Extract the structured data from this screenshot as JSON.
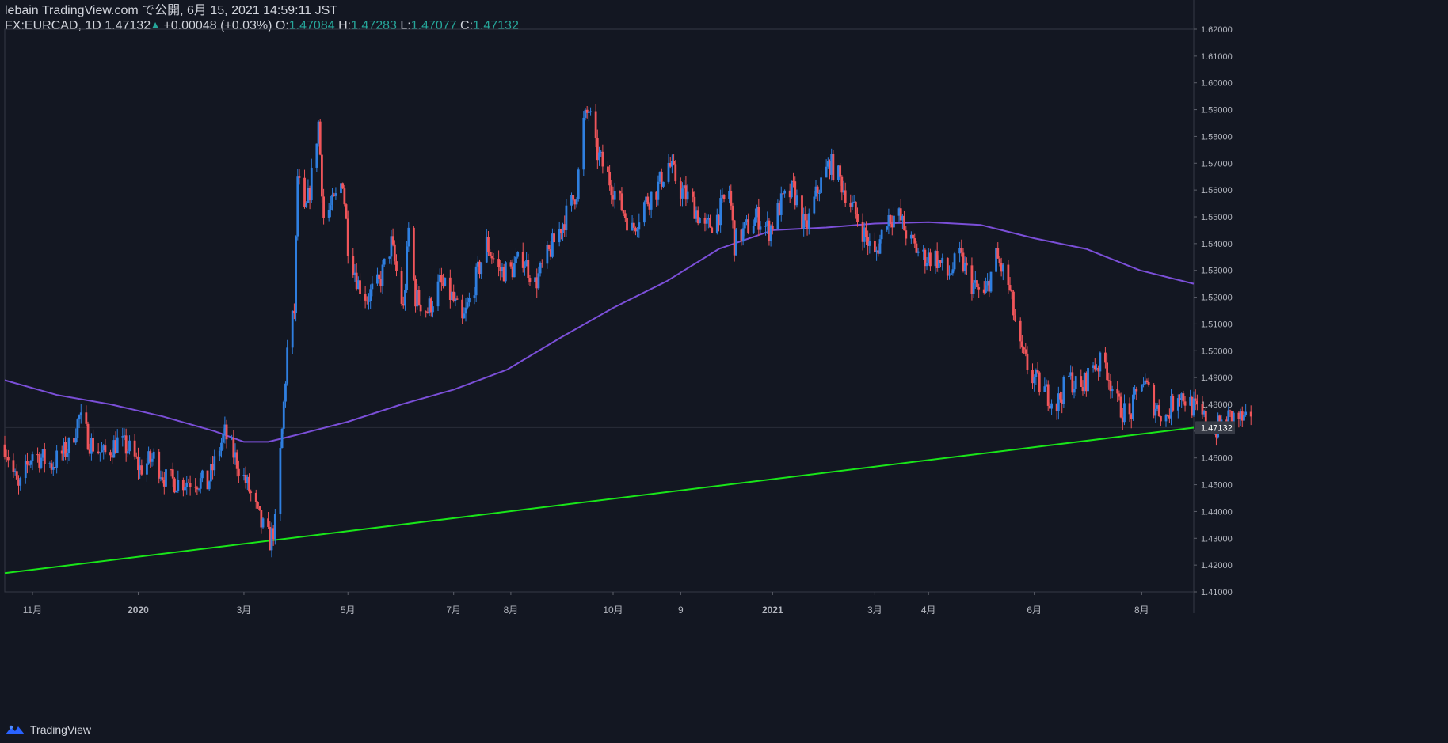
{
  "header": {
    "published": "lebain TradingView.com で公開, 6月 15, 2021 14:59:11 JST",
    "symbol": "FX:EURCAD, 1D",
    "last": "1.47132",
    "change": "+0.00048 (+0.03%)",
    "o_label": "O:",
    "o_value": "1.47084",
    "h_label": "H:",
    "h_value": "1.47283",
    "l_label": "L:",
    "l_value": "1.47077",
    "c_label": "C:",
    "c_value": "1.47132"
  },
  "footer": {
    "brand": "TradingView"
  },
  "colors": {
    "background": "#131722",
    "up": "#2f7fe0",
    "down": "#f0555a",
    "ma": "#7b4fd8",
    "trendline": "#19e619",
    "text": "#d1d4dc",
    "header_value": "#26a69a"
  },
  "chart_data": {
    "type": "candlestick",
    "symbol": "FX:EURCAD",
    "timeframe": "1D",
    "x_range": [
      "2019-10-16",
      "2021-09-01"
    ],
    "y_range": [
      1.41,
      1.62
    ],
    "y_ticks": [
      "1.41000",
      "1.42000",
      "1.43000",
      "1.44000",
      "1.45000",
      "1.46000",
      "1.47000",
      "1.48000",
      "1.49000",
      "1.50000",
      "1.51000",
      "1.52000",
      "1.53000",
      "1.54000",
      "1.55000",
      "1.56000",
      "1.57000",
      "1.58000",
      "1.59000",
      "1.60000",
      "1.61000",
      "1.62000"
    ],
    "x_ticks": [
      {
        "label": "11月",
        "date": "2019-11-01"
      },
      {
        "label": "2020",
        "date": "2020-01-01"
      },
      {
        "label": "3月",
        "date": "2020-03-02"
      },
      {
        "label": "5月",
        "date": "2020-05-01"
      },
      {
        "label": "7月",
        "date": "2020-07-01"
      },
      {
        "label": "8月",
        "date": "2020-08-03"
      },
      {
        "label": "10月",
        "date": "2020-10-01"
      },
      {
        "label": "9",
        "date": "2020-11-09"
      },
      {
        "label": "2021",
        "date": "2021-01-01"
      },
      {
        "label": "3月",
        "date": "2021-03-01"
      },
      {
        "label": "4月",
        "date": "2021-04-01"
      },
      {
        "label": "6月",
        "date": "2021-06-01"
      },
      {
        "label": "8月",
        "date": "2021-08-02"
      }
    ],
    "last_price_label": "1.47132",
    "last_price": 1.47132,
    "close_path": [
      [
        "2019-10-16",
        1.465
      ],
      [
        "2019-10-24",
        1.448
      ],
      [
        "2019-11-01",
        1.462
      ],
      [
        "2019-11-12",
        1.4575
      ],
      [
        "2019-11-22",
        1.464
      ],
      [
        "2019-11-28",
        1.475
      ],
      [
        "2019-12-04",
        1.466
      ],
      [
        "2019-12-12",
        1.461
      ],
      [
        "2019-12-20",
        1.466
      ],
      [
        "2019-12-27",
        1.463
      ],
      [
        "2020-01-02",
        1.456
      ],
      [
        "2020-01-10",
        1.46
      ],
      [
        "2020-01-17",
        1.452
      ],
      [
        "2020-01-24",
        1.451
      ],
      [
        "2020-02-03",
        1.452
      ],
      [
        "2020-02-10",
        1.45
      ],
      [
        "2020-02-17",
        1.464
      ],
      [
        "2020-02-20",
        1.469
      ],
      [
        "2020-02-26",
        1.46
      ],
      [
        "2020-03-05",
        1.448
      ],
      [
        "2020-03-12",
        1.435
      ],
      [
        "2020-03-17",
        1.429
      ],
      [
        "2020-03-20",
        1.435
      ],
      [
        "2020-03-24",
        1.47
      ],
      [
        "2020-03-27",
        1.5
      ],
      [
        "2020-03-31",
        1.515
      ],
      [
        "2020-04-02",
        1.565
      ],
      [
        "2020-04-06",
        1.55
      ],
      [
        "2020-04-09",
        1.56
      ],
      [
        "2020-04-14",
        1.585
      ],
      [
        "2020-04-17",
        1.55
      ],
      [
        "2020-04-23",
        1.555
      ],
      [
        "2020-04-28",
        1.564
      ],
      [
        "2020-05-01",
        1.54
      ],
      [
        "2020-05-07",
        1.525
      ],
      [
        "2020-05-12",
        1.52
      ],
      [
        "2020-05-19",
        1.525
      ],
      [
        "2020-05-26",
        1.54
      ],
      [
        "2020-06-02",
        1.515
      ],
      [
        "2020-06-05",
        1.545
      ],
      [
        "2020-06-09",
        1.52
      ],
      [
        "2020-06-16",
        1.515
      ],
      [
        "2020-06-23",
        1.525
      ],
      [
        "2020-06-30",
        1.52
      ],
      [
        "2020-07-06",
        1.51
      ],
      [
        "2020-07-13",
        1.525
      ],
      [
        "2020-07-20",
        1.54
      ],
      [
        "2020-07-27",
        1.53
      ],
      [
        "2020-08-03",
        1.53
      ],
      [
        "2020-08-10",
        1.535
      ],
      [
        "2020-08-17",
        1.525
      ],
      [
        "2020-08-24",
        1.535
      ],
      [
        "2020-08-31",
        1.545
      ],
      [
        "2020-09-07",
        1.555
      ],
      [
        "2020-09-10",
        1.56
      ],
      [
        "2020-09-14",
        1.585
      ],
      [
        "2020-09-17",
        1.59
      ],
      [
        "2020-09-21",
        1.575
      ],
      [
        "2020-09-28",
        1.565
      ],
      [
        "2020-10-05",
        1.555
      ],
      [
        "2020-10-12",
        1.545
      ],
      [
        "2020-10-19",
        1.555
      ],
      [
        "2020-10-26",
        1.56
      ],
      [
        "2020-11-02",
        1.57
      ],
      [
        "2020-11-09",
        1.56
      ],
      [
        "2020-11-16",
        1.555
      ],
      [
        "2020-11-23",
        1.545
      ],
      [
        "2020-11-30",
        1.55
      ],
      [
        "2020-12-07",
        1.56
      ],
      [
        "2020-12-10",
        1.54
      ],
      [
        "2020-12-16",
        1.545
      ],
      [
        "2020-12-23",
        1.55
      ],
      [
        "2020-12-30",
        1.545
      ],
      [
        "2021-01-06",
        1.555
      ],
      [
        "2021-01-13",
        1.56
      ],
      [
        "2021-01-20",
        1.545
      ],
      [
        "2021-01-27",
        1.56
      ],
      [
        "2021-02-03",
        1.57
      ],
      [
        "2021-02-08",
        1.565
      ],
      [
        "2021-02-15",
        1.555
      ],
      [
        "2021-02-22",
        1.545
      ],
      [
        "2021-03-01",
        1.535
      ],
      [
        "2021-03-08",
        1.55
      ],
      [
        "2021-03-15",
        1.55
      ],
      [
        "2021-03-22",
        1.54
      ],
      [
        "2021-03-29",
        1.535
      ],
      [
        "2021-04-05",
        1.535
      ],
      [
        "2021-04-12",
        1.528
      ],
      [
        "2021-04-19",
        1.535
      ],
      [
        "2021-04-26",
        1.525
      ],
      [
        "2021-05-03",
        1.52
      ],
      [
        "2021-05-10",
        1.535
      ],
      [
        "2021-05-17",
        1.525
      ],
      [
        "2021-05-24",
        1.5
      ],
      [
        "2021-05-31",
        1.49
      ],
      [
        "2021-06-07",
        1.485
      ],
      [
        "2021-06-14",
        1.48
      ],
      [
        "2021-06-21",
        1.49
      ],
      [
        "2021-06-28",
        1.485
      ],
      [
        "2021-07-05",
        1.495
      ],
      [
        "2021-07-12",
        1.495
      ],
      [
        "2021-07-19",
        1.48
      ],
      [
        "2021-07-26",
        1.475
      ],
      [
        "2021-08-02",
        1.49
      ],
      [
        "2021-08-09",
        1.48
      ],
      [
        "2021-08-16",
        1.475
      ],
      [
        "2021-08-23",
        1.485
      ],
      [
        "2021-08-30",
        1.48
      ],
      [
        "2021-09-06",
        1.475
      ],
      [
        "2021-09-13",
        1.47
      ],
      [
        "2021-09-20",
        1.475
      ],
      [
        "2021-09-27",
        1.475
      ],
      [
        "2021-10-04",
        1.4713
      ]
    ],
    "moving_average": [
      [
        "2019-10-16",
        1.489
      ],
      [
        "2019-11-15",
        1.4835
      ],
      [
        "2019-12-16",
        1.48
      ],
      [
        "2020-01-15",
        1.4755
      ],
      [
        "2020-02-14",
        1.47
      ],
      [
        "2020-03-02",
        1.466
      ],
      [
        "2020-03-16",
        1.466
      ],
      [
        "2020-04-01",
        1.4685
      ],
      [
        "2020-05-01",
        1.4735
      ],
      [
        "2020-06-01",
        1.48
      ],
      [
        "2020-07-01",
        1.4855
      ],
      [
        "2020-08-01",
        1.493
      ],
      [
        "2020-09-01",
        1.505
      ],
      [
        "2020-10-01",
        1.516
      ],
      [
        "2020-11-01",
        1.526
      ],
      [
        "2020-12-01",
        1.538
      ],
      [
        "2021-01-01",
        1.545
      ],
      [
        "2021-02-01",
        1.546
      ],
      [
        "2021-03-01",
        1.5475
      ],
      [
        "2021-04-01",
        1.548
      ],
      [
        "2021-05-01",
        1.547
      ],
      [
        "2021-06-01",
        1.542
      ],
      [
        "2021-07-01",
        1.538
      ],
      [
        "2021-08-01",
        1.53
      ],
      [
        "2021-09-01",
        1.525
      ]
    ],
    "trendline": [
      [
        "2019-10-16",
        1.417
      ],
      [
        "2021-09-01",
        1.4713
      ]
    ]
  }
}
